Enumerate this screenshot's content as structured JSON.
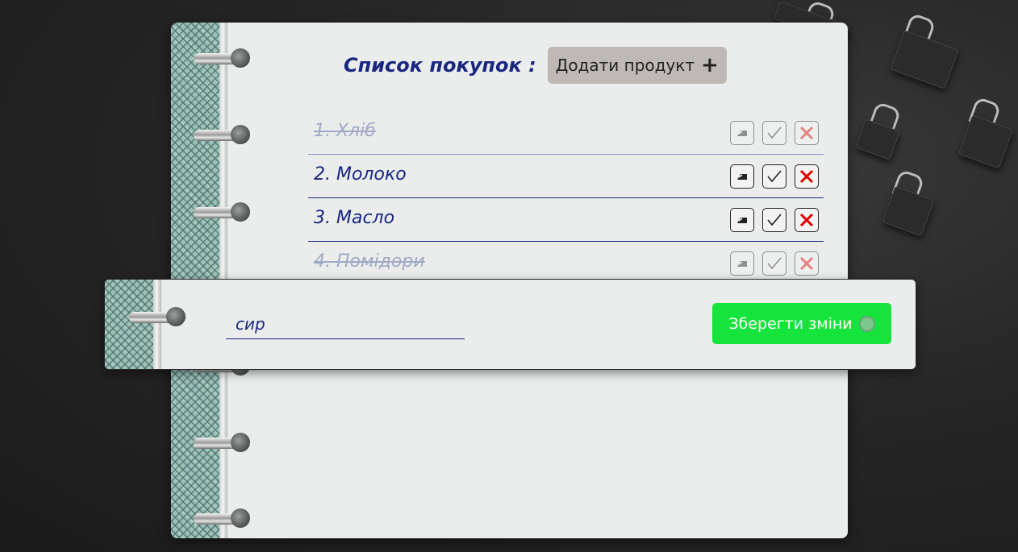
{
  "header": {
    "title": "Список покупок :",
    "add_label": "Додати продукт",
    "add_icon": "plus-icon"
  },
  "items": [
    {
      "label": "1. Хліб",
      "done": true
    },
    {
      "label": "2. Молоко",
      "done": false
    },
    {
      "label": "3. Масло",
      "done": false
    },
    {
      "label": "4. Помідори",
      "done": true
    }
  ],
  "edit": {
    "value": "сир",
    "save_label": "Зберегти зміни",
    "save_icon": "circle-icon"
  },
  "colors": {
    "accent": "#1a2680",
    "save": "#16e43d",
    "delete": "#e00000",
    "add_button": "#bfb9b6"
  }
}
